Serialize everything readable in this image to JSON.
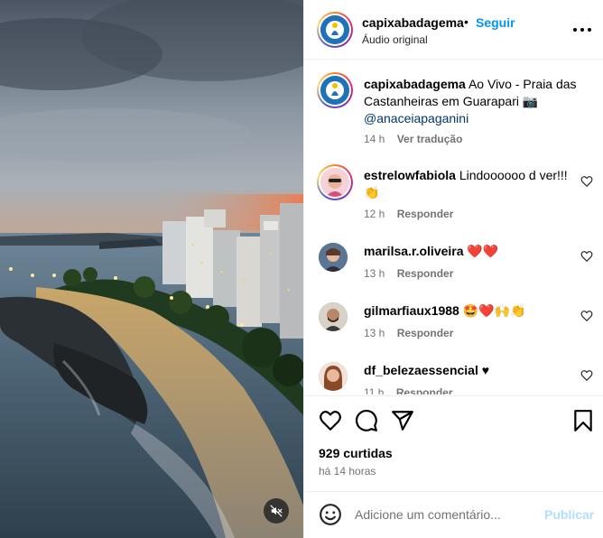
{
  "post": {
    "username": "capixabadagema",
    "separator": "•",
    "follow_label": "Seguir",
    "audio_label": "Áudio original",
    "caption_text": "Ao Vivo - Praia das Castanheiras em Guarapari 📷",
    "caption_mention": "@anaceiapaganini",
    "caption_time": "14 h",
    "caption_translate": "Ver tradução",
    "more_icon": "more-horizontal-icon"
  },
  "comments": [
    {
      "username": "estrelowfabiola",
      "text": "Lindoooooo d ver!!! 👏",
      "time": "12 h",
      "reply": "Responder",
      "avatar_color": "#f2c1c9"
    },
    {
      "username": "marilsa.r.oliveira",
      "text": "❤️❤️",
      "time": "13 h",
      "reply": "Responder",
      "avatar_color": "#4d6a8a"
    },
    {
      "username": "gilmarfiaux1988",
      "text": "🤩❤️🙌👏",
      "time": "13 h",
      "reply": "Responder",
      "avatar_color": "#a07a5c"
    },
    {
      "username": "df_belezaessencial",
      "text": "♥",
      "time": "11 h",
      "reply": "Responder",
      "avatar_color": "#c98a6a"
    }
  ],
  "footer": {
    "likes": "929 curtidas",
    "time_ago": "há 14 horas",
    "comment_placeholder": "Adicione um comentário...",
    "publish_label": "Publicar"
  },
  "colors": {
    "accent": "#0095f6",
    "link": "#00376b",
    "muted": "#737373",
    "publish_disabled": "#b2dffc"
  },
  "icons": [
    "heart-icon",
    "comment-icon",
    "share-icon",
    "bookmark-icon",
    "emoji-icon",
    "mute-icon",
    "more-horizontal-icon"
  ]
}
